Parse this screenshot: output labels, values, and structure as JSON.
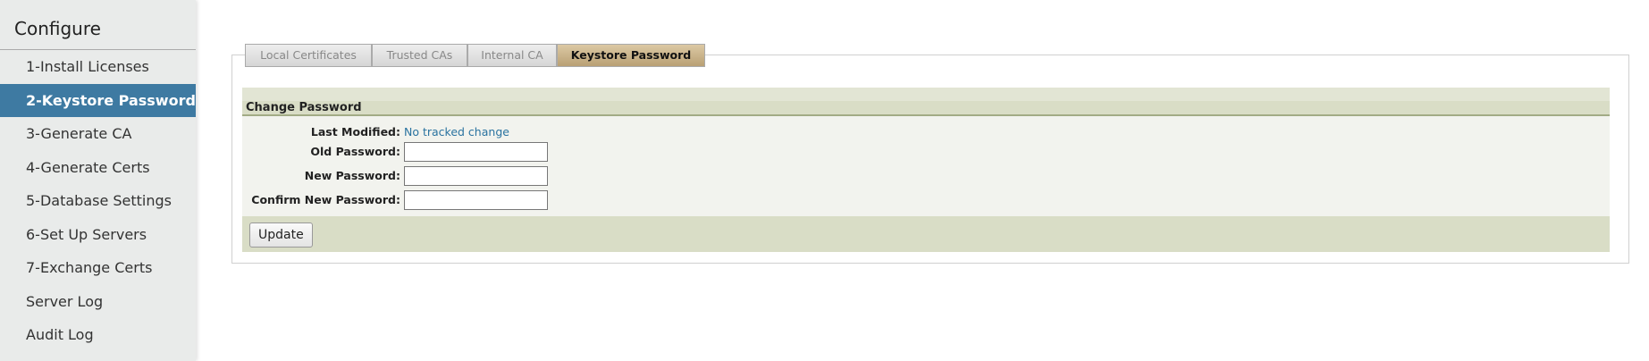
{
  "sidebar": {
    "title": "Configure",
    "items": [
      {
        "label": "1-Install Licenses"
      },
      {
        "label": "2-Keystore Password"
      },
      {
        "label": "3-Generate CA"
      },
      {
        "label": "4-Generate Certs"
      },
      {
        "label": "5-Database Settings"
      },
      {
        "label": "6-Set Up Servers"
      },
      {
        "label": "7-Exchange Certs"
      },
      {
        "label": "Server Log"
      },
      {
        "label": "Audit Log"
      }
    ],
    "active_index": 1
  },
  "tabs": [
    {
      "label": "Local Certificates"
    },
    {
      "label": "Trusted CAs"
    },
    {
      "label": "Internal CA"
    },
    {
      "label": "Keystore Password"
    }
  ],
  "form": {
    "title": "Change Password",
    "last_modified_label": "Last Modified:",
    "last_modified_value": "No tracked change",
    "old_password_label": "Old Password:",
    "old_password_value": "",
    "new_password_label": "New Password:",
    "new_password_value": "",
    "confirm_password_label": "Confirm New Password:",
    "confirm_password_value": "",
    "update_label": "Update"
  }
}
